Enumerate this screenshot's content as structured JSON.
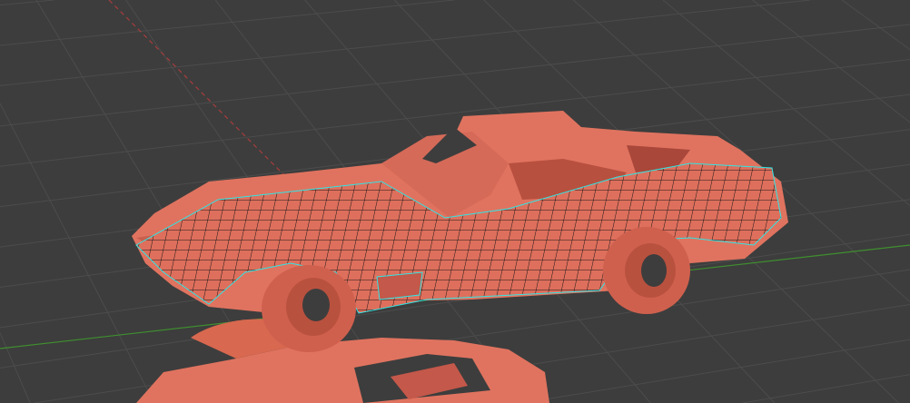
{
  "viewport": {
    "background_color": "#3d3d3d",
    "grid_color": "#4c4c4c",
    "x_axis_color": "#a83c3c",
    "y_axis_color": "#3f8f2f"
  },
  "model": {
    "body_color": "#e0735f",
    "shadow_color": "#b3503f",
    "wire_color": "#111111",
    "seam_color": "#2ee6e6"
  }
}
